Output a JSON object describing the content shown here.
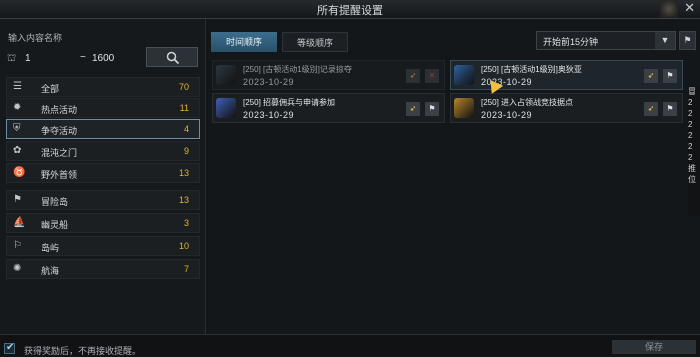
{
  "window": {
    "title": "所有提醒设置",
    "close": "✕"
  },
  "left": {
    "label": "输入内容名称",
    "range": {
      "icon": "⛫",
      "min": "1",
      "separator": "~",
      "max": "1600"
    },
    "categories": [
      {
        "icon": "☰",
        "name": "全部",
        "count": "70"
      },
      {
        "icon": "✹",
        "name": "热点活动",
        "count": "11"
      },
      {
        "icon": "⛨",
        "name": "争夺活动",
        "count": "4"
      },
      {
        "icon": "✿",
        "name": "混沌之门",
        "count": "9"
      },
      {
        "icon": "♉",
        "name": "野外首领",
        "count": "13"
      },
      {
        "icon": "⚑",
        "name": "冒险岛",
        "count": "13"
      },
      {
        "icon": "⛵",
        "name": "幽灵船",
        "count": "3"
      },
      {
        "icon": "⚐",
        "name": "岛屿",
        "count": "10"
      },
      {
        "icon": "✺",
        "name": "航海",
        "count": "7"
      }
    ]
  },
  "tabs": [
    "时间顺序",
    "等级顺序"
  ],
  "dropdown": {
    "value": "开始前15分钟",
    "arrow": "▼"
  },
  "cards": [
    {
      "title": "[250] [古顿活动1级别]记录掠夺",
      "date": "2023-10-29",
      "thumb": "#3b4a58",
      "b1": "➶",
      "b2": "✕"
    },
    {
      "title": "[250] [古顿活动1级别]奥狄亚",
      "date": "2023-10-29",
      "thumb": "#2f5f9e",
      "b1": "➶",
      "b2": "⚑"
    },
    {
      "title": "[250] 招募佣兵与申请参加",
      "date": "2023-10-29",
      "thumb": "#3f5fb8",
      "b1": "➶",
      "b2": "⚑"
    },
    {
      "title": "[250] 进入占领战竞技据点",
      "date": "2023-10-29",
      "thumb": "#b8862a",
      "b1": "➶",
      "b2": "⚑"
    }
  ],
  "footer": {
    "checkbox_label": "获得奖励后，不再接收提醒。",
    "save": "保存"
  },
  "side_glyphs": [
    "冒",
    "2",
    "2",
    "2",
    "2",
    "2",
    "2",
    "推",
    "位"
  ],
  "colors": {
    "accent": "#3c6f8d",
    "count": "#e3b528"
  }
}
